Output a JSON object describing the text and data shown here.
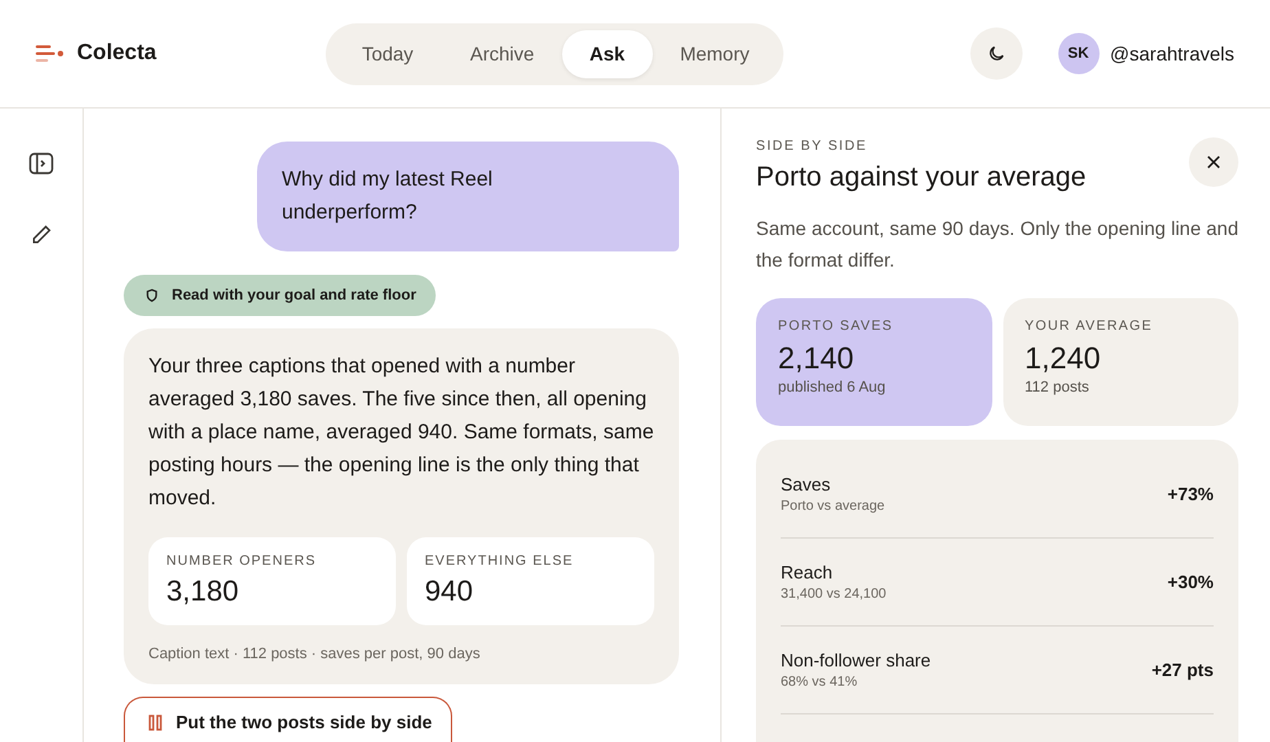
{
  "brand": {
    "name": "Colecta"
  },
  "tabs": [
    {
      "label": "Today",
      "selected": false
    },
    {
      "label": "Archive",
      "selected": false
    },
    {
      "label": "Ask",
      "selected": true
    },
    {
      "label": "Memory",
      "selected": false
    }
  ],
  "user": {
    "initials": "SK",
    "handle": "@sarahtravels"
  },
  "chat": {
    "question": "Why did my latest Reel underperform?",
    "context_chip": "Read with your goal and rate floor",
    "answer": "Your three captions that opened with a number averaged 3,180 saves. The five since then, all opening with a place name, averaged 940. Same formats, same posting hours — the opening line is the only thing that moved.",
    "stats": [
      {
        "label": "NUMBER OPENERS",
        "value": "3,180"
      },
      {
        "label": "EVERYTHING ELSE",
        "value": "940"
      }
    ],
    "source": "Caption text · 112 posts · saves per post, 90 days",
    "action": "Put the two posts side by side"
  },
  "panel": {
    "eyebrow": "SIDE BY SIDE",
    "title": "Porto against your average",
    "description": "Same account, same 90 days. Only the opening line and the format differ.",
    "cards": [
      {
        "label": "PORTO SAVES",
        "value": "2,140",
        "note": "published 6 Aug",
        "selected": true
      },
      {
        "label": "YOUR AVERAGE",
        "value": "1,240",
        "note": "112 posts",
        "selected": false
      }
    ],
    "rows": [
      {
        "name": "Saves",
        "detail": "Porto vs average",
        "change": "+73%"
      },
      {
        "name": "Reach",
        "detail": "31,400 vs 24,100",
        "change": "+30%"
      },
      {
        "name": "Non-follower share",
        "detail": "68% vs 41%",
        "change": "+27 pts"
      }
    ]
  }
}
